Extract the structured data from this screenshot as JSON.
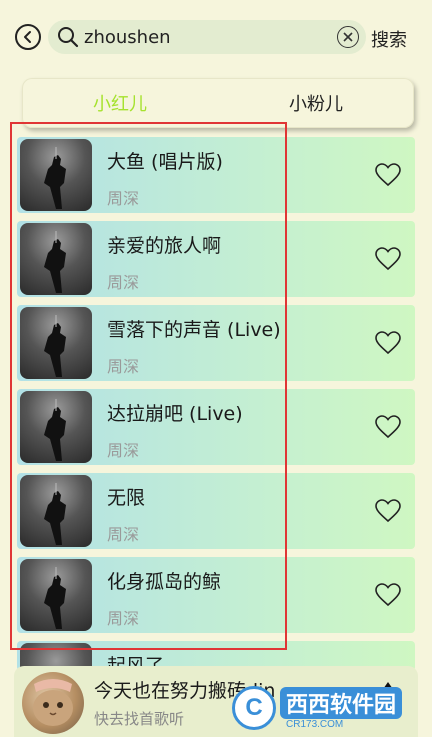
{
  "search": {
    "query": "zhoushen",
    "submit_label": "搜索"
  },
  "tabs": [
    {
      "label": "小红儿",
      "active": true
    },
    {
      "label": "小粉儿",
      "active": false
    }
  ],
  "songs": [
    {
      "title": "大鱼 (唱片版)",
      "artist": "周深"
    },
    {
      "title": "亲爱的旅人啊",
      "artist": "周深"
    },
    {
      "title": "雪落下的声音 (Live)",
      "artist": "周深"
    },
    {
      "title": "达拉崩吧 (Live)",
      "artist": "周深"
    },
    {
      "title": "无限",
      "artist": "周深"
    },
    {
      "title": "化身孤岛的鲸",
      "artist": "周深"
    },
    {
      "title": "起风了",
      "artist": ""
    }
  ],
  "player": {
    "title": "今天也在努力搬砖-lin",
    "subtitle": "快去找首歌听"
  },
  "watermark": {
    "main": "西西软件园",
    "sub": "CR173.COM"
  },
  "colors": {
    "accent_tab": "#a6e22e",
    "highlight_box": "#e03535",
    "background": "#f6f5dc"
  }
}
